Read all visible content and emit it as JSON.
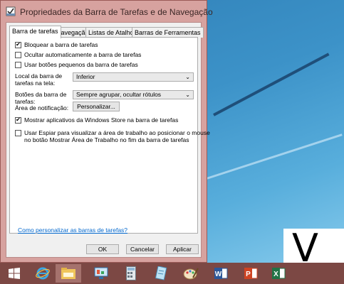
{
  "window": {
    "title": "Propriedades da Barra de Tarefas e de Navegação"
  },
  "tabs": [
    {
      "label": "Barra de tarefas"
    },
    {
      "label": "Navegação"
    },
    {
      "label": "Listas de Atalhos"
    },
    {
      "label": "Barras de Ferramentas"
    }
  ],
  "options": {
    "lock": {
      "label": "Bloquear a barra de tarefas",
      "checked": true
    },
    "autohide": {
      "label": "Ocultar automaticamente a barra de tarefas",
      "checked": false
    },
    "small_buttons": {
      "label": "Usar botões pequenos da barra de tarefas",
      "checked": false
    },
    "store_apps": {
      "label": "Mostrar aplicativos da Windows Store na barra de tarefas",
      "checked": true
    },
    "peek_line1": "Usar Espiar para visualizar a área de trabalho ao posicionar o mouse",
    "peek_line2": "no botão Mostrar Área de Trabalho no fim da barra de tarefas",
    "peek_checked": false
  },
  "location": {
    "label_line1": "Local da barra de",
    "label_line2": "tarefas na tela:",
    "value": "Inferior"
  },
  "buttons_setting": {
    "label_line1": "Botões da barra de",
    "label_line2": "tarefas:",
    "value": "Sempre agrupar, ocultar rótulos"
  },
  "notification": {
    "label": "Área de notificação:",
    "button": "Personalizar..."
  },
  "help_link": "Como personalizar as barras de tarefas?",
  "dialog_buttons": {
    "ok": "OK",
    "cancel": "Cancelar",
    "apply": "Aplicar"
  },
  "watermark_letter": "V",
  "taskbar_icons": [
    "windows-logo-icon",
    "internet-explorer-icon",
    "file-explorer-icon",
    "control-panel-icon",
    "calculator-icon",
    "notepad-icon",
    "paint-icon",
    "word-icon",
    "powerpoint-icon",
    "excel-icon"
  ],
  "colors": {
    "window_frame": "#d7a29f",
    "taskbar": "#7c4844",
    "link": "#0066cc"
  }
}
